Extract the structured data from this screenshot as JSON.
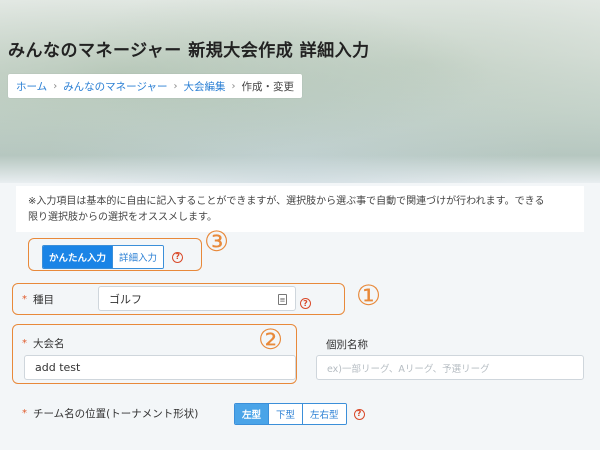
{
  "header": {
    "title": "みんなのマネージャー 新規大会作成 詳細入力",
    "breadcrumb": [
      {
        "label": "ホーム",
        "link": true
      },
      {
        "label": "みんなのマネージャー",
        "link": true
      },
      {
        "label": "大会編集",
        "link": true
      },
      {
        "label": "作成・変更",
        "link": false
      }
    ],
    "breadcrumb_sep": "›"
  },
  "notice": {
    "line1": "※入力項目は基本的に自由に記入することができますが、選択肢から選ぶ事で自動で関連づけが行われます。できる",
    "line2": "限り選択肢からの選択をオススメします。"
  },
  "input_mode": {
    "options": [
      "かんたん入力",
      "詳細入力"
    ],
    "selected": "かんたん入力"
  },
  "annotations": {
    "one": "①",
    "two": "②",
    "three": "③"
  },
  "form": {
    "required_mark": "*",
    "sport": {
      "label": "種目",
      "value": "ゴルフ"
    },
    "tournament_name": {
      "label": "大会名",
      "value": "add test"
    },
    "individual_name": {
      "label": "個別名称",
      "placeholder": "ex)一部リーグ、Aリーグ、予選リーグ"
    },
    "team_position": {
      "label": "チーム名の位置(トーナメント形状)",
      "options": [
        "左型",
        "下型",
        "左右型"
      ],
      "selected": "左型"
    },
    "help_glyph": "?"
  },
  "colors": {
    "accent_blue": "#1a84e6",
    "annotation_orange": "#e8893a",
    "required_red": "#e05a2a"
  }
}
